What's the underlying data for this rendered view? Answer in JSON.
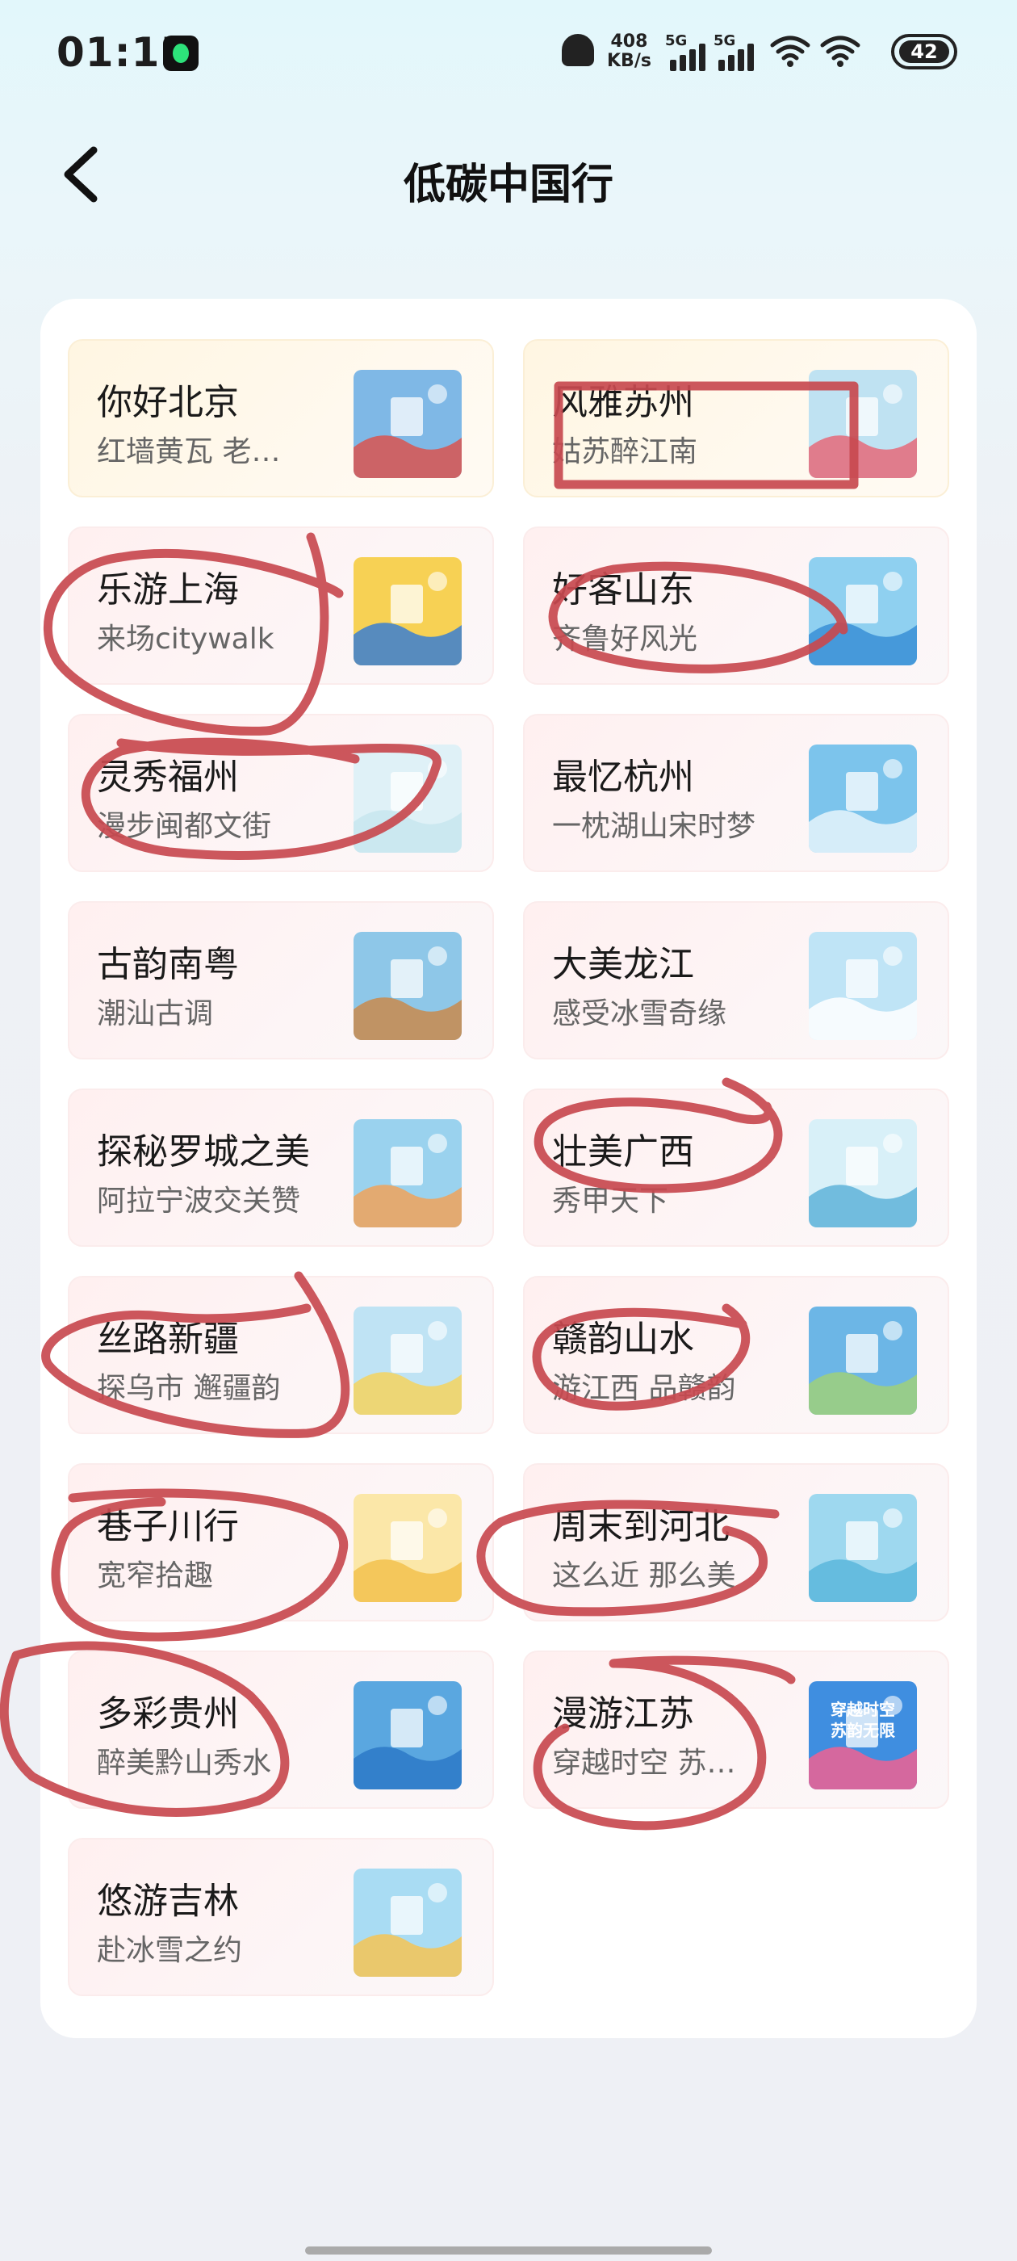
{
  "status_bar": {
    "time": "01:15",
    "net_speed_value": "408",
    "net_speed_unit": "KB/s",
    "signal1_label": "5G",
    "signal2_label": "5G",
    "battery": "42"
  },
  "header": {
    "title": "低碳中国行"
  },
  "cities": [
    {
      "name": "你好北京",
      "subtitle": "红墙黄瓦 老…",
      "style": "gold",
      "thumb_colors": [
        "#7fb8e6",
        "#d9534f"
      ]
    },
    {
      "name": "风雅苏州",
      "subtitle": "姑苏醉江南",
      "style": "gold",
      "thumb_colors": [
        "#bfe2f2",
        "#e56a7a"
      ]
    },
    {
      "name": "乐游上海",
      "subtitle": "来场citywalk",
      "style": "pink",
      "thumb_colors": [
        "#f7d154",
        "#3b7fd1"
      ]
    },
    {
      "name": "好客山东",
      "subtitle": "齐鲁好风光",
      "style": "pink",
      "thumb_colors": [
        "#8fd0f0",
        "#3a8fd6"
      ]
    },
    {
      "name": "灵秀福州",
      "subtitle": "漫步闽都文街",
      "style": "pink",
      "thumb_colors": [
        "#dff1f7",
        "#c8e6ef"
      ]
    },
    {
      "name": "最忆杭州",
      "subtitle": "一枕湖山宋时梦",
      "style": "pink",
      "thumb_colors": [
        "#7cc4ec",
        "#e6f4fb"
      ]
    },
    {
      "name": "古韵南粤",
      "subtitle": "潮汕古调",
      "style": "pink",
      "thumb_colors": [
        "#8ec7e8",
        "#c98a4c"
      ]
    },
    {
      "name": "大美龙江",
      "subtitle": "感受冰雪奇缘",
      "style": "pink",
      "thumb_colors": [
        "#bfe4f6",
        "#ffffff"
      ]
    },
    {
      "name": "探秘罗城之美",
      "subtitle": "阿拉宁波交关赞",
      "style": "pink",
      "thumb_colors": [
        "#9ad2ee",
        "#f0a35a"
      ]
    },
    {
      "name": "壮美广西",
      "subtitle": "秀甲天下",
      "style": "pink",
      "thumb_colors": [
        "#d8f0f8",
        "#5fb3d9"
      ]
    },
    {
      "name": "丝路新疆",
      "subtitle": "探乌市 邂疆韵",
      "style": "pink",
      "thumb_colors": [
        "#bfe3f4",
        "#f4d35e"
      ]
    },
    {
      "name": "赣韵山水",
      "subtitle": "游江西 品赣韵",
      "style": "pink",
      "thumb_colors": [
        "#6cb6e6",
        "#9fd07a"
      ]
    },
    {
      "name": "巷子川行",
      "subtitle": "宽窄拾趣",
      "style": "pink",
      "thumb_colors": [
        "#fbe7a8",
        "#f2c14e"
      ]
    },
    {
      "name": "周末到河北",
      "subtitle": "这么近 那么美",
      "style": "pink",
      "thumb_colors": [
        "#9ed8ef",
        "#5bb7dc"
      ]
    },
    {
      "name": "多彩贵州",
      "subtitle": "醉美黔山秀水",
      "style": "pink",
      "thumb_colors": [
        "#5aa7e0",
        "#2d79c7"
      ]
    },
    {
      "name": "漫游江苏",
      "subtitle": "穿越时空 苏…",
      "style": "pink",
      "thumb_colors": [
        "#3f8ee0",
        "#f06292"
      ],
      "thumb_text": "穿越时空 苏韵无限"
    },
    {
      "name": "悠游吉林",
      "subtitle": "赴冰雪之约",
      "style": "pink",
      "thumb_colors": [
        "#a9dcf3",
        "#f6c453"
      ]
    }
  ],
  "annotation_color": "#c8494f"
}
